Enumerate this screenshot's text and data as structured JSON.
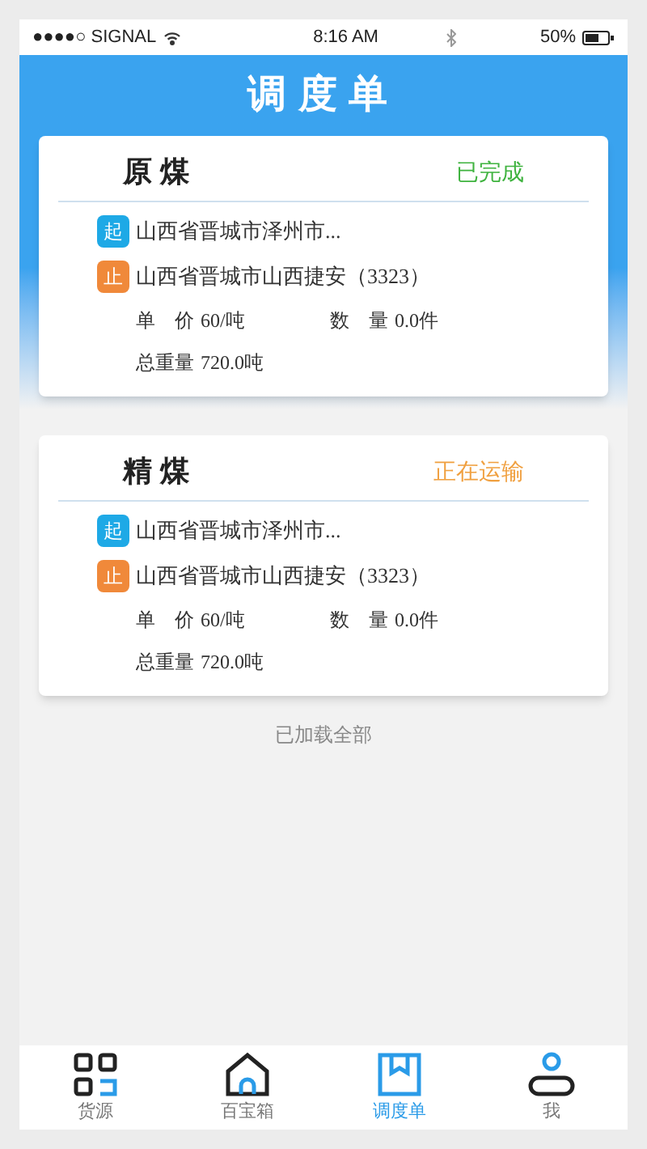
{
  "status_bar": {
    "signal": "●●●●○ SIGNAL",
    "time": "8:16 AM",
    "battery": "50%"
  },
  "title": "调度单",
  "orders": [
    {
      "name": "原 煤",
      "status": "已完成",
      "kind": "done",
      "start_tag": "起",
      "start": "山西省晋城市泽州市...",
      "end_tag": "止",
      "end": "山西省晋城市山西捷安（3323）",
      "price_label": "单　价",
      "price": "60/吨",
      "qty_label": "数　量",
      "qty": "0.0件",
      "weight_label": "总重量",
      "weight": "720.0吨"
    },
    {
      "name": "精 煤",
      "status": "正在运输",
      "kind": "shipping",
      "start_tag": "起",
      "start": "山西省晋城市泽州市...",
      "end_tag": "止",
      "end": "山西省晋城市山西捷安（3323）",
      "price_label": "单　价",
      "price": "60/吨",
      "qty_label": "数　量",
      "qty": "0.0件",
      "weight_label": "总重量",
      "weight": "720.0吨"
    }
  ],
  "footer": "已加载全部",
  "tabs": [
    {
      "label": "货源",
      "kind": "grid",
      "selected": false
    },
    {
      "label": "百宝箱",
      "kind": "home",
      "selected": false
    },
    {
      "label": "调度单",
      "kind": "box",
      "selected": true
    },
    {
      "label": "我",
      "kind": "user",
      "selected": false
    }
  ]
}
